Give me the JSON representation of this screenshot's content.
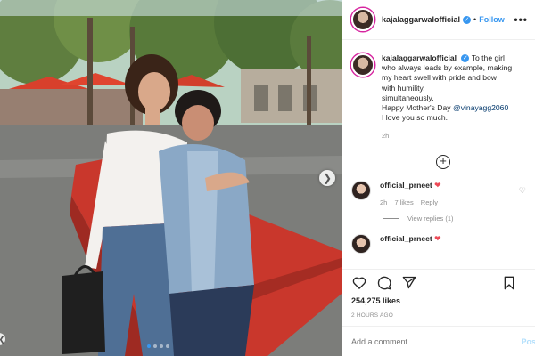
{
  "post": {
    "username": "kajalaggarwalofficial",
    "verified": true,
    "follow_label": "Follow",
    "separator": "•",
    "more_label": "•••",
    "caption_lines": [
      "To the girl",
      "who always leads by example, making",
      "my heart swell with pride and bow",
      "with humility,",
      "simultaneously.",
      "Happy Mother's Day",
      "I love you so much."
    ],
    "caption_mention": "@vinayagg2060",
    "caption_time": "2h",
    "likes": "254,275 likes",
    "posted_ago": "2 HOURS AGO",
    "add_comment_placeholder": "Add a comment...",
    "post_label": "Post"
  },
  "comments": [
    {
      "username": "official_prneet",
      "emoji": "❤",
      "time": "2h",
      "likes": "7 likes",
      "reply_label": "Reply",
      "view_replies": "View replies (1)"
    },
    {
      "username": "official_prneet",
      "emoji": "❤"
    }
  ],
  "carousel": {
    "slide_count": 4,
    "active_index": 0
  },
  "icons": {
    "heart": "heart-icon",
    "comment": "comment-icon",
    "share": "share-icon",
    "bookmark": "bookmark-icon",
    "verified": "verified-badge-icon",
    "add_circle": "plus-circle-icon",
    "next": "chevron-right-icon",
    "prev": "chevron-left-icon"
  },
  "colors": {
    "accent": "#3897f0",
    "heart_red": "#ed4956",
    "muted": "#8e8e8e"
  }
}
